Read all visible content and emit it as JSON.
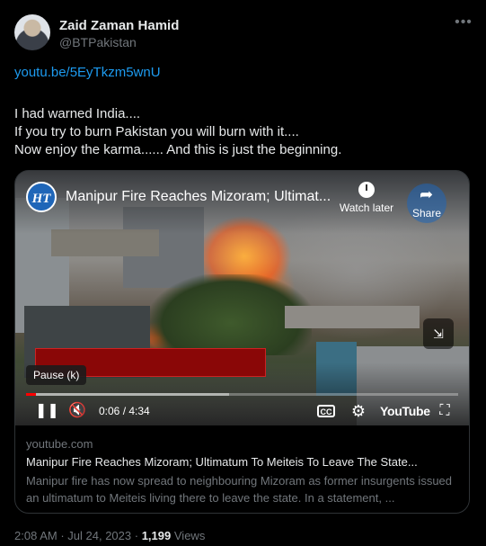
{
  "author": {
    "name": "Zaid Zaman Hamid",
    "handle": "@BTPakistan"
  },
  "tweet": {
    "link": "youtu.be/5EyTkzm5wnU",
    "lines": [
      "I had warned India....",
      "If you try to burn Pakistan you will burn with it....",
      "Now enjoy the karma...... And this is just the beginning."
    ]
  },
  "video": {
    "channel_logo_text": "HT",
    "title": "Manipur Fire Reaches Mizoram; Ultimat...",
    "watch_later_label": "Watch later",
    "share_label": "Share",
    "tooltip": "Pause (k)",
    "current_time": "0:06",
    "duration": "4:34",
    "time_display": "0:06 / 4:34",
    "progress_fraction": 0.022,
    "buffered_fraction": 0.47,
    "cc_label": "CC",
    "brand": "YouTube"
  },
  "card": {
    "domain": "youtube.com",
    "title": "Manipur Fire Reaches Mizoram; Ultimatum To Meiteis To Leave The State...",
    "description": "Manipur fire has now spread to neighbouring Mizoram as former insurgents issued an ultimatum to Meiteis living there to leave the state. In a statement, ..."
  },
  "footer": {
    "time": "2:08 AM",
    "date": "Jul 24, 2023",
    "views_count": "1,199",
    "views_label": "Views"
  },
  "icons": {
    "more": "more-horizontal-icon",
    "pause": "pause-icon",
    "mute": "muted-speaker-icon",
    "settings": "gear-icon",
    "fullscreen": "fullscreen-icon",
    "pip": "picture-in-picture-icon"
  },
  "colors": {
    "link": "#1d9bf0",
    "progress": "#ff0000",
    "background": "#000000"
  }
}
